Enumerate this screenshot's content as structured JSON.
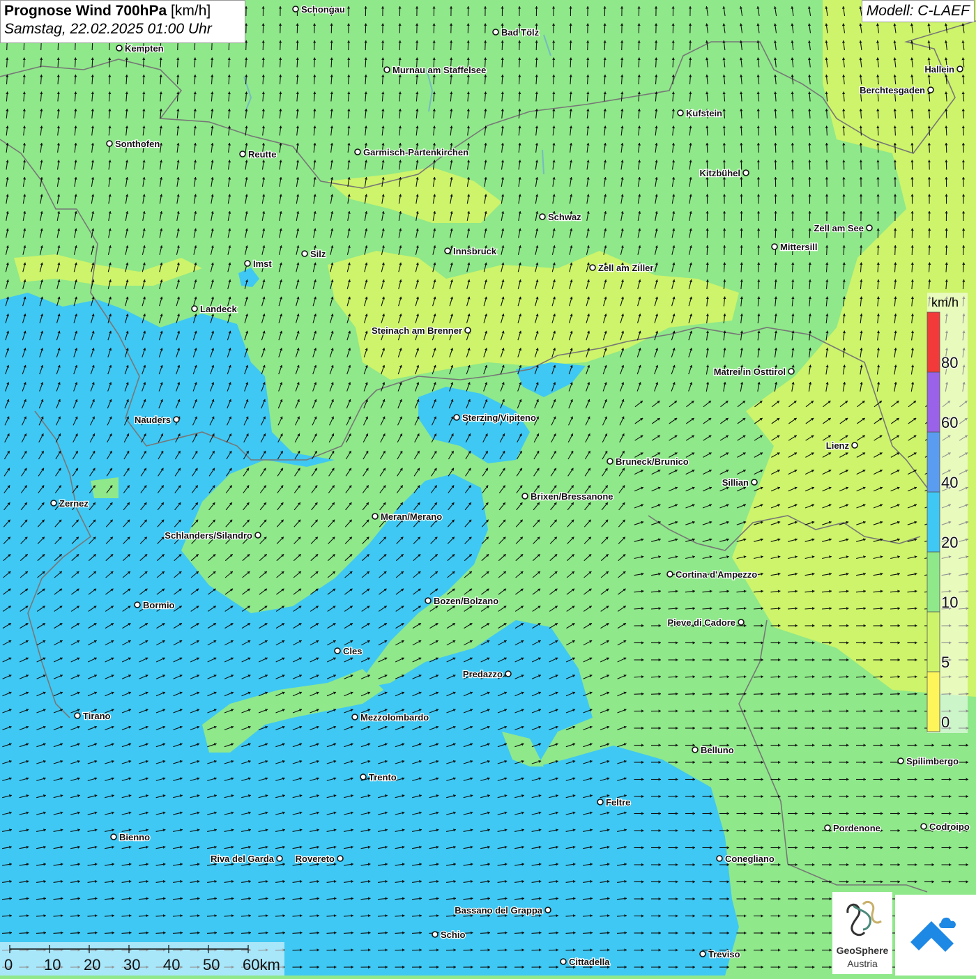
{
  "title": {
    "bold": "Prognose Wind 700hPa",
    "unit": "[km/h]",
    "datetime": "Samstag, 22.02.2025 01:00 Uhr"
  },
  "model": "Modell: C-LAEF",
  "legend": {
    "unit": "km/h",
    "bins": [
      {
        "from": 0,
        "to": 5,
        "color": "#fdf55a"
      },
      {
        "from": 5,
        "to": 10,
        "color": "#cdf46a"
      },
      {
        "from": 10,
        "to": 20,
        "color": "#8fe88a"
      },
      {
        "from": 20,
        "to": 40,
        "color": "#3fc8f4"
      },
      {
        "from": 40,
        "to": 60,
        "color": "#5a9cf0"
      },
      {
        "from": 60,
        "to": 80,
        "color": "#9a62e8"
      },
      {
        "from": 80,
        "to": null,
        "color": "#f23a3a"
      }
    ],
    "labels": [
      "0",
      "5",
      "10",
      "20",
      "40",
      "60",
      "80"
    ]
  },
  "scalebar": {
    "labels": [
      "0",
      "10",
      "20",
      "30",
      "40",
      "50",
      "60km"
    ]
  },
  "cities": [
    {
      "name": "Schongau"
    },
    {
      "name": "Bad Tölz"
    },
    {
      "name": "Kempten"
    },
    {
      "name": "Murnau am Staffelsee"
    },
    {
      "name": "Hallein"
    },
    {
      "name": "Berchtesgaden"
    },
    {
      "name": "Kufstein"
    },
    {
      "name": "Sonthofen"
    },
    {
      "name": "Reutte"
    },
    {
      "name": "Garmisch-Partenkirchen"
    },
    {
      "name": "Kitzbühel"
    },
    {
      "name": "Schwaz"
    },
    {
      "name": "Zell am See"
    },
    {
      "name": "Mittersill"
    },
    {
      "name": "Imst"
    },
    {
      "name": "Silz"
    },
    {
      "name": "Innsbruck"
    },
    {
      "name": "Zell am Ziller"
    },
    {
      "name": "Landeck"
    },
    {
      "name": "Steinach am Brenner"
    },
    {
      "name": "Matrei in Osttirol"
    },
    {
      "name": "Nauders"
    },
    {
      "name": "Sterzing/Vipiteno"
    },
    {
      "name": "Lienz"
    },
    {
      "name": "Bruneck/Brunico"
    },
    {
      "name": "Sillian"
    },
    {
      "name": "Brixen/Bressanone"
    },
    {
      "name": "Zernez"
    },
    {
      "name": "Meran/Merano"
    },
    {
      "name": "Schlanders/Silandro"
    },
    {
      "name": "Cortina d'Ampezzo"
    },
    {
      "name": "Bormio"
    },
    {
      "name": "Bozen/Bolzano"
    },
    {
      "name": "Pieve di Cadore"
    },
    {
      "name": "Cles"
    },
    {
      "name": "Predazzo"
    },
    {
      "name": "Tirano"
    },
    {
      "name": "Mezzolombardo"
    },
    {
      "name": "Belluno"
    },
    {
      "name": "Spilimbergo"
    },
    {
      "name": "Trento"
    },
    {
      "name": "Feltre"
    },
    {
      "name": "Pordenone"
    },
    {
      "name": "Codroipo"
    },
    {
      "name": "Bienno"
    },
    {
      "name": "Riva del Garda"
    },
    {
      "name": "Rovereto"
    },
    {
      "name": "Conegliano"
    },
    {
      "name": "Bassano del Grappa"
    },
    {
      "name": "Schio"
    },
    {
      "name": "Treviso"
    },
    {
      "name": "Cittadella"
    }
  ],
  "logos": {
    "geosphere_line1": "GeoSphere",
    "geosphere_line2": "Austria"
  }
}
